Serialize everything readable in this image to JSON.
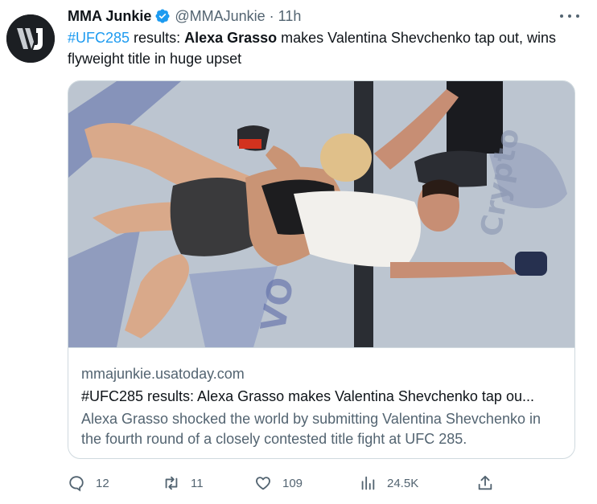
{
  "author": {
    "display_name": "MMA Junkie",
    "handle": "@MMAJunkie",
    "separator": "·",
    "time": "11h",
    "avatar_icon": "mma-junkie-logo",
    "verified_icon": "verified-badge-icon"
  },
  "tweet": {
    "hashtag": "#UFC285",
    "text_part1": " results: ",
    "bold_name": "Alexa Grasso",
    "text_part2": " makes Valentina Shevchenko tap out, wins flyweight title in huge upset"
  },
  "card": {
    "domain": "mmajunkie.usatoday.com",
    "title": "#UFC285 results: Alexa Grasso makes Valentina Shevchenko tap ou...",
    "description": "Alexa Grasso shocked the world by submitting Valentina Shevchenko in the fourth round of a closely contested title fight at UFC 285."
  },
  "actions": {
    "replies": "12",
    "retweets": "11",
    "likes": "109",
    "views": "24.5K"
  },
  "colors": {
    "accent": "#1d9bf0",
    "text": "#0f1419",
    "muted": "#536471",
    "border": "#cfd9de"
  }
}
